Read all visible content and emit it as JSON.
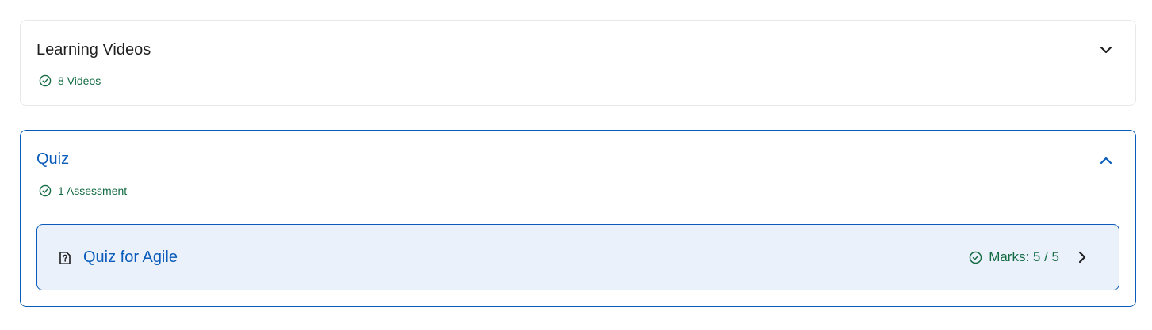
{
  "sections": {
    "videos": {
      "title": "Learning Videos",
      "meta": "8 Videos",
      "toggle_icon": "chevron-down-icon"
    },
    "quiz": {
      "title": "Quiz",
      "meta": "1 Assessment",
      "toggle_icon": "chevron-up-icon",
      "items": [
        {
          "title": "Quiz for Agile",
          "marks": "Marks: 5 / 5",
          "icon": "quiz-document-icon"
        }
      ]
    }
  },
  "colors": {
    "accent": "#0b5cba",
    "success": "#146c43",
    "item_bg": "#eaf1fb",
    "border": "#e6e8eb"
  }
}
